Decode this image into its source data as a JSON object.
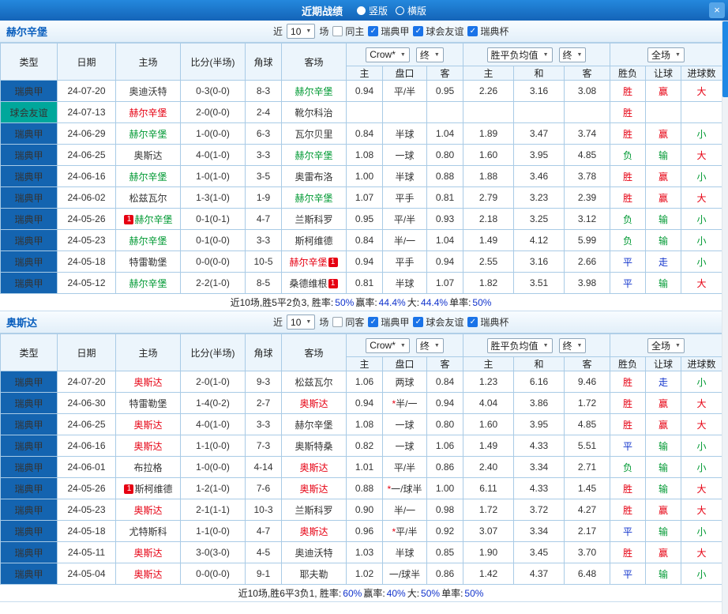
{
  "colors": {
    "red": "#e60012",
    "green": "#009933",
    "blue": "#1133cc",
    "black": "#333333",
    "teamGreen": "#009933",
    "typeBlue": "#1464b0",
    "typeTeal": "#00a79b"
  },
  "topbar": {
    "title": "近期战绩",
    "layout_vertical": "竖版",
    "layout_horizontal": "横版",
    "close_icon": "×"
  },
  "table_headers": {
    "type": "类型",
    "date": "日期",
    "home": "主场",
    "score": "比分(半场)",
    "corner": "角球",
    "away": "客场",
    "asia_home": "主",
    "asia_hcap": "盘口",
    "asia_away": "客",
    "euro_home": "主",
    "euro_draw": "和",
    "euro_away": "客",
    "result": "胜负",
    "hcap_result": "让球",
    "goals": "进球数"
  },
  "controls": {
    "near": "近",
    "count": "10",
    "games": "场",
    "bookmaker": "Crow*",
    "final1": "终",
    "avg": "胜平负均值",
    "final2": "终",
    "fullmatch": "全场"
  },
  "sections": [
    {
      "team": "赫尔辛堡",
      "same_label": "同主",
      "leagues": [
        "瑞典甲",
        "球会友谊",
        "瑞典杯"
      ],
      "rows": [
        {
          "league": "瑞典甲",
          "lc": "blue",
          "date": "24-07-20",
          "home": {
            "name": "奥迪沃特",
            "color": "black"
          },
          "score": "0-3(0-0)",
          "corner": "8-3",
          "away": {
            "name": "赫尔辛堡",
            "color": "green"
          },
          "asia": [
            "0.94",
            "平/半",
            "0.95"
          ],
          "euro": [
            "2.26",
            "3.16",
            "3.08"
          ],
          "res": [
            "胜",
            "赢",
            "大"
          ]
        },
        {
          "league": "球会友谊",
          "lc": "teal",
          "date": "24-07-13",
          "home": {
            "name": "赫尔辛堡",
            "color": "red"
          },
          "score": "2-0(0-0)",
          "corner": "2-4",
          "away": {
            "name": "靴尔科治",
            "color": "black"
          },
          "asia": [
            "",
            "",
            ""
          ],
          "euro": [
            "",
            "",
            ""
          ],
          "res": [
            "胜",
            "",
            ""
          ]
        },
        {
          "league": "瑞典甲",
          "lc": "blue",
          "date": "24-06-29",
          "home": {
            "name": "赫尔辛堡",
            "color": "green"
          },
          "score": "1-0(0-0)",
          "corner": "6-3",
          "away": {
            "name": "瓦尔贝里",
            "color": "black"
          },
          "asia": [
            "0.84",
            "半球",
            "1.04"
          ],
          "euro": [
            "1.89",
            "3.47",
            "3.74"
          ],
          "res": [
            "胜",
            "赢",
            "小"
          ]
        },
        {
          "league": "瑞典甲",
          "lc": "blue",
          "date": "24-06-25",
          "home": {
            "name": "奥斯达",
            "color": "black"
          },
          "score": "4-0(1-0)",
          "corner": "3-3",
          "away": {
            "name": "赫尔辛堡",
            "color": "green"
          },
          "asia": [
            "1.08",
            "一球",
            "0.80"
          ],
          "euro": [
            "1.60",
            "3.95",
            "4.85"
          ],
          "res": [
            "负",
            "输",
            "大"
          ]
        },
        {
          "league": "瑞典甲",
          "lc": "blue",
          "date": "24-06-16",
          "home": {
            "name": "赫尔辛堡",
            "color": "green"
          },
          "score": "1-0(1-0)",
          "corner": "3-5",
          "away": {
            "name": "奥雷布洛",
            "color": "black"
          },
          "asia": [
            "1.00",
            "半球",
            "0.88"
          ],
          "euro": [
            "1.88",
            "3.46",
            "3.78"
          ],
          "res": [
            "胜",
            "赢",
            "小"
          ]
        },
        {
          "league": "瑞典甲",
          "lc": "blue",
          "date": "24-06-02",
          "home": {
            "name": "松兹瓦尔",
            "color": "black"
          },
          "score": "1-3(1-0)",
          "corner": "1-9",
          "away": {
            "name": "赫尔辛堡",
            "color": "green"
          },
          "asia": [
            "1.07",
            "平手",
            "0.81"
          ],
          "euro": [
            "2.79",
            "3.23",
            "2.39"
          ],
          "res": [
            "胜",
            "赢",
            "大"
          ]
        },
        {
          "league": "瑞典甲",
          "lc": "blue",
          "date": "24-05-26",
          "home": {
            "name": "赫尔辛堡",
            "color": "green",
            "badge": {
              "text": "1",
              "pos": "before"
            }
          },
          "score": "0-1(0-1)",
          "corner": "4-7",
          "away": {
            "name": "兰斯科罗",
            "color": "black"
          },
          "asia": [
            "0.95",
            "平/半",
            "0.93"
          ],
          "euro": [
            "2.18",
            "3.25",
            "3.12"
          ],
          "res": [
            "负",
            "输",
            "小"
          ]
        },
        {
          "league": "瑞典甲",
          "lc": "blue",
          "date": "24-05-23",
          "home": {
            "name": "赫尔辛堡",
            "color": "green"
          },
          "score": "0-1(0-0)",
          "corner": "3-3",
          "away": {
            "name": "斯柯维德",
            "color": "black"
          },
          "asia": [
            "0.84",
            "半/一",
            "1.04"
          ],
          "euro": [
            "1.49",
            "4.12",
            "5.99"
          ],
          "res": [
            "负",
            "输",
            "小"
          ]
        },
        {
          "league": "瑞典甲",
          "lc": "blue",
          "date": "24-05-18",
          "home": {
            "name": "特雷勒堡",
            "color": "black"
          },
          "score": "0-0(0-0)",
          "corner": "10-5",
          "away": {
            "name": "赫尔辛堡",
            "color": "red",
            "badge": {
              "text": "1",
              "pos": "after"
            }
          },
          "asia": [
            "0.94",
            "平手",
            "0.94"
          ],
          "euro": [
            "2.55",
            "3.16",
            "2.66"
          ],
          "res": [
            "平",
            "走",
            "小"
          ]
        },
        {
          "league": "瑞典甲",
          "lc": "blue",
          "date": "24-05-12",
          "home": {
            "name": "赫尔辛堡",
            "color": "green"
          },
          "score": "2-2(1-0)",
          "corner": "8-5",
          "away": {
            "name": "桑德维根",
            "color": "black",
            "badge": {
              "text": "1",
              "pos": "after"
            }
          },
          "asia": [
            "0.81",
            "半球",
            "1.07"
          ],
          "euro": [
            "1.82",
            "3.51",
            "3.98"
          ],
          "res": [
            "平",
            "输",
            "大"
          ]
        }
      ],
      "summary": [
        {
          "t": "近10场,胜5平2负3, 胜率:"
        },
        {
          "t": "50%",
          "b": true
        },
        {
          "t": " 赢率:"
        },
        {
          "t": "44.4%",
          "b": true
        },
        {
          "t": " 大:"
        },
        {
          "t": "44.4%",
          "b": true
        },
        {
          "t": " 单率:"
        },
        {
          "t": "50%",
          "b": true
        }
      ]
    },
    {
      "team": "奥斯达",
      "same_label": "同客",
      "leagues": [
        "瑞典甲",
        "球会友谊",
        "瑞典杯"
      ],
      "rows": [
        {
          "league": "瑞典甲",
          "lc": "blue",
          "date": "24-07-20",
          "home": {
            "name": "奥斯达",
            "color": "red"
          },
          "score": "2-0(1-0)",
          "corner": "9-3",
          "away": {
            "name": "松兹瓦尔",
            "color": "black"
          },
          "asia": [
            "1.06",
            "两球",
            "0.84"
          ],
          "euro": [
            "1.23",
            "6.16",
            "9.46"
          ],
          "res": [
            "胜",
            "走",
            "小"
          ]
        },
        {
          "league": "瑞典甲",
          "lc": "blue",
          "date": "24-06-30",
          "home": {
            "name": "特雷勒堡",
            "color": "black"
          },
          "score": "1-4(0-2)",
          "corner": "2-7",
          "away": {
            "name": "奥斯达",
            "color": "red"
          },
          "asia": [
            "0.94",
            "*半/一",
            "0.94"
          ],
          "euro": [
            "4.04",
            "3.86",
            "1.72"
          ],
          "res": [
            "胜",
            "赢",
            "大"
          ]
        },
        {
          "league": "瑞典甲",
          "lc": "blue",
          "date": "24-06-25",
          "home": {
            "name": "奥斯达",
            "color": "red"
          },
          "score": "4-0(1-0)",
          "corner": "3-3",
          "away": {
            "name": "赫尔辛堡",
            "color": "black"
          },
          "asia": [
            "1.08",
            "一球",
            "0.80"
          ],
          "euro": [
            "1.60",
            "3.95",
            "4.85"
          ],
          "res": [
            "胜",
            "赢",
            "大"
          ]
        },
        {
          "league": "瑞典甲",
          "lc": "blue",
          "date": "24-06-16",
          "home": {
            "name": "奥斯达",
            "color": "red"
          },
          "score": "1-1(0-0)",
          "corner": "7-3",
          "away": {
            "name": "奥斯特桑",
            "color": "black"
          },
          "asia": [
            "0.82",
            "一球",
            "1.06"
          ],
          "euro": [
            "1.49",
            "4.33",
            "5.51"
          ],
          "res": [
            "平",
            "输",
            "小"
          ]
        },
        {
          "league": "瑞典甲",
          "lc": "blue",
          "date": "24-06-01",
          "home": {
            "name": "布拉格",
            "color": "black"
          },
          "score": "1-0(0-0)",
          "corner": "4-14",
          "away": {
            "name": "奥斯达",
            "color": "red"
          },
          "asia": [
            "1.01",
            "平/半",
            "0.86"
          ],
          "euro": [
            "2.40",
            "3.34",
            "2.71"
          ],
          "res": [
            "负",
            "输",
            "小"
          ]
        },
        {
          "league": "瑞典甲",
          "lc": "blue",
          "date": "24-05-26",
          "home": {
            "name": "斯柯维德",
            "color": "black",
            "badge": {
              "text": "1",
              "pos": "before"
            }
          },
          "score": "1-2(1-0)",
          "corner": "7-6",
          "away": {
            "name": "奥斯达",
            "color": "red"
          },
          "asia": [
            "0.88",
            "*一/球半",
            "1.00"
          ],
          "euro": [
            "6.11",
            "4.33",
            "1.45"
          ],
          "res": [
            "胜",
            "输",
            "大"
          ]
        },
        {
          "league": "瑞典甲",
          "lc": "blue",
          "date": "24-05-23",
          "home": {
            "name": "奥斯达",
            "color": "red"
          },
          "score": "2-1(1-1)",
          "corner": "10-3",
          "away": {
            "name": "兰斯科罗",
            "color": "black"
          },
          "asia": [
            "0.90",
            "半/一",
            "0.98"
          ],
          "euro": [
            "1.72",
            "3.72",
            "4.27"
          ],
          "res": [
            "胜",
            "赢",
            "大"
          ]
        },
        {
          "league": "瑞典甲",
          "lc": "blue",
          "date": "24-05-18",
          "home": {
            "name": "尤特斯科",
            "color": "black"
          },
          "score": "1-1(0-0)",
          "corner": "4-7",
          "away": {
            "name": "奥斯达",
            "color": "red"
          },
          "asia": [
            "0.96",
            "*平/半",
            "0.92"
          ],
          "euro": [
            "3.07",
            "3.34",
            "2.17"
          ],
          "res": [
            "平",
            "输",
            "小"
          ]
        },
        {
          "league": "瑞典甲",
          "lc": "blue",
          "date": "24-05-11",
          "home": {
            "name": "奥斯达",
            "color": "red"
          },
          "score": "3-0(3-0)",
          "corner": "4-5",
          "away": {
            "name": "奥迪沃特",
            "color": "black"
          },
          "asia": [
            "1.03",
            "半球",
            "0.85"
          ],
          "euro": [
            "1.90",
            "3.45",
            "3.70"
          ],
          "res": [
            "胜",
            "赢",
            "大"
          ]
        },
        {
          "league": "瑞典甲",
          "lc": "blue",
          "date": "24-05-04",
          "home": {
            "name": "奥斯达",
            "color": "red"
          },
          "score": "0-0(0-0)",
          "corner": "9-1",
          "away": {
            "name": "耶夫勒",
            "color": "black"
          },
          "asia": [
            "1.02",
            "一/球半",
            "0.86"
          ],
          "euro": [
            "1.42",
            "4.37",
            "6.48"
          ],
          "res": [
            "平",
            "输",
            "小"
          ]
        }
      ],
      "summary": [
        {
          "t": "近10场,胜6平3负1, 胜率:"
        },
        {
          "t": "60%",
          "b": true
        },
        {
          "t": " 赢率:"
        },
        {
          "t": "40%",
          "b": true
        },
        {
          "t": " 大:"
        },
        {
          "t": "50%",
          "b": true
        },
        {
          "t": " 单率:"
        },
        {
          "t": "50%",
          "b": true
        }
      ]
    }
  ]
}
